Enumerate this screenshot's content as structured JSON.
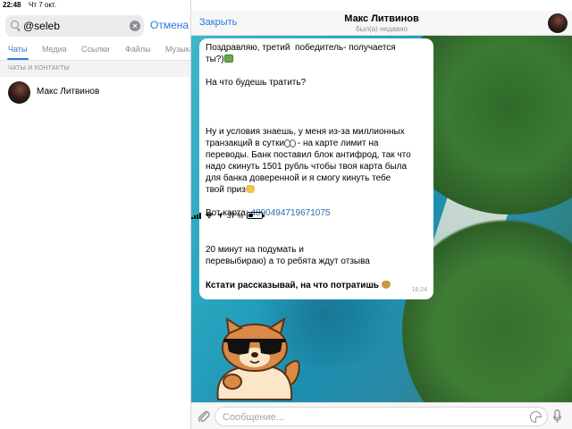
{
  "status_bar": {
    "time": "22:48",
    "date": "Чт 7 окт.",
    "battery": "37 %",
    "battery_level": 0.37
  },
  "search": {
    "value": "@seleb",
    "cancel_label": "Отмена"
  },
  "tabs": [
    {
      "label": "Чаты",
      "active": true
    },
    {
      "label": "Медиа",
      "active": false
    },
    {
      "label": "Ссылки",
      "active": false
    },
    {
      "label": "Файлы",
      "active": false
    },
    {
      "label": "Музыка",
      "active": false
    }
  ],
  "section_header": "ЧАТЫ И КОНТАКТЫ",
  "contacts": [
    {
      "name": "Макс Литвинов"
    }
  ],
  "chat": {
    "close_label": "Закрыть",
    "title": "Макс Литвинов",
    "subtitle": "был(а) недавно",
    "message": {
      "p1_l1": "Поздравляю, третий  победитель- получается",
      "p1_l2": "ты?)",
      "p2": "На что будешь тратить?",
      "p3_l1": "Ну и условия знаешь, у меня из-за миллионных",
      "p3_l2": "транзакций в сутки",
      "p3_l2b": " - на карте лимит на",
      "p3_l3": "переводы. Банк поставил блок антифрод, так что",
      "p3_l4": "надо скинуть 1501 рубль чтобы твоя карта была",
      "p3_l5": "для банка доверенной и я смогу кинуть тебе",
      "p3_l6": "твой приз",
      "card_label": "Вот карта: ",
      "card_number": "4890494719671075",
      "p5_l1": "20 минут на подумать и",
      "p5_l2": "перевыбираю) а то ребята ждут отзыва",
      "p6": "Кстати рассказывай, на что потратишь",
      "time": "16:24"
    },
    "input_placeholder": "Сообщение..."
  },
  "colors": {
    "accent": "#2b7bd9",
    "link": "#2b6cb0"
  }
}
